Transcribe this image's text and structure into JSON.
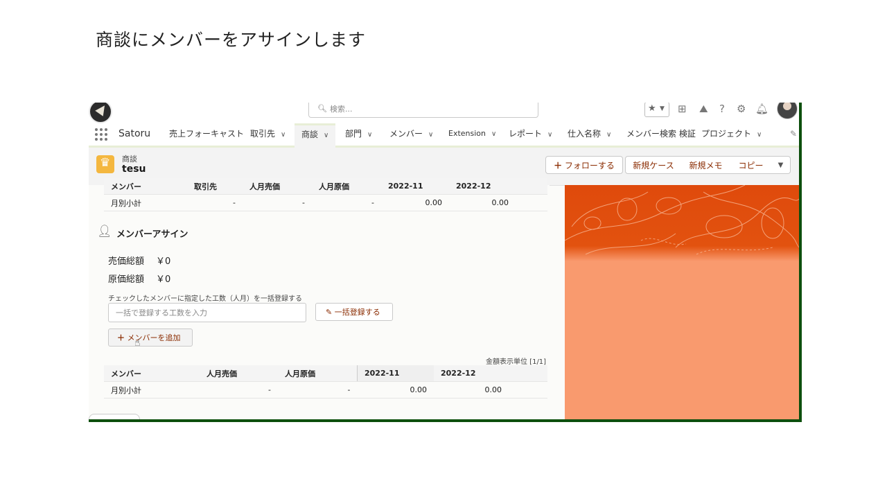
{
  "slide": {
    "title": "商談にメンバーをアサインします"
  },
  "header": {
    "search_placeholder": "検索...",
    "icons": [
      "star-icon",
      "add-icon",
      "trailhead-icon",
      "help-icon",
      "setup-icon",
      "bell-icon"
    ]
  },
  "nav": {
    "app_name": "Satoru",
    "items": [
      {
        "label": "売上フォーキャスト",
        "has_menu": false
      },
      {
        "label": "取引先",
        "has_menu": true
      },
      {
        "label": "商談",
        "has_menu": true,
        "active": true
      },
      {
        "label": "部門",
        "has_menu": true
      },
      {
        "label": "メンバー",
        "has_menu": true
      },
      {
        "label": "Extension",
        "has_menu": true
      },
      {
        "label": "レポート",
        "has_menu": true
      },
      {
        "label": "仕入名称",
        "has_menu": true
      },
      {
        "label": "メンバー検索 検証",
        "has_menu": false
      },
      {
        "label": "プロジェクト",
        "has_menu": true
      }
    ]
  },
  "record": {
    "object_label": "商談",
    "name": "tesu",
    "actions": {
      "follow": "フォローする",
      "new_case": "新規ケース",
      "new_memo": "新規メモ",
      "copy": "コピー"
    }
  },
  "top_table": {
    "headers": [
      "メンバー",
      "取引先",
      "人月売価",
      "人月原価",
      "2022-11",
      "2022-12"
    ],
    "row": [
      "月別小計",
      "-",
      "-",
      "-",
      "0.00",
      "0.00"
    ]
  },
  "assign": {
    "section_title": "メンバーアサイン",
    "sales_total_label": "売価総額",
    "sales_total_value": "￥0",
    "cost_total_label": "原価総額",
    "cost_total_value": "￥0",
    "bulk_hint": "チェックしたメンバーに指定した工数（人月）を一括登録する",
    "bulk_placeholder": "一括で登録する工数を入力",
    "bulk_button": "一括登録する",
    "add_member_button": "メンバーを追加",
    "unit_label": "金額表示単位 [1/1]"
  },
  "bottom_table": {
    "headers": [
      "メンバー",
      "人月売価",
      "人月原価",
      "2022-11",
      "2022-12"
    ],
    "row": [
      "月別小計",
      "-",
      "-",
      "0.00",
      "0.00"
    ]
  },
  "colors": {
    "brand_orange": "#e2520f",
    "accent_text": "#8a2b00",
    "crown": "#f4b73f",
    "frame_green": "#0d4f0d"
  }
}
